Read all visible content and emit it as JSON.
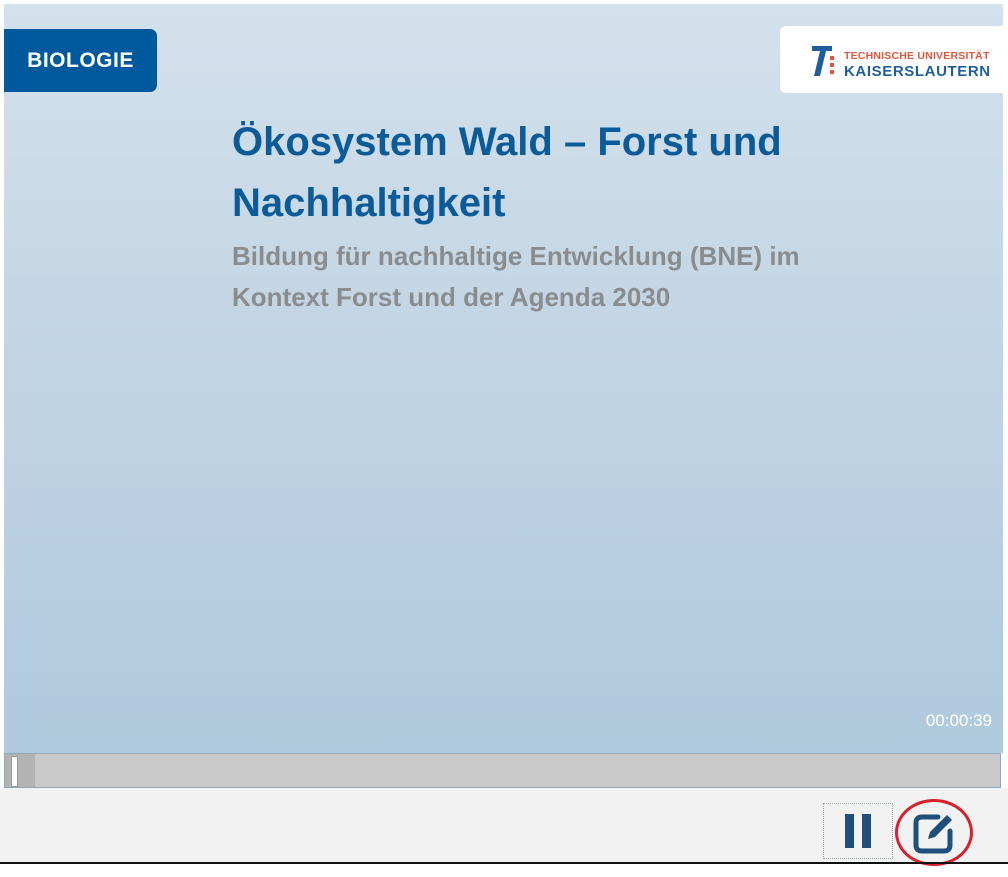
{
  "slide": {
    "badge": "BIOLOGIE",
    "logo": {
      "line1": "TECHNISCHE UNIVERSITÄT",
      "line2": "KAISERSLAUTERN"
    },
    "title_line1": "Ökosystem Wald – Forst und",
    "title_line2": "Nachhaltigkeit",
    "subtitle_line1": "Bildung für nachhaltige Entwicklung (BNE) im",
    "subtitle_line2": "Kontext Forst und der Agenda 2030"
  },
  "player": {
    "timestamp": "00:00:39",
    "progress": 0.03,
    "pause_icon": "pause-icon",
    "notes_icon": "edit-note-icon"
  },
  "colors": {
    "brand_blue": "#00599c",
    "title_blue": "#0c5b99",
    "subtitle_gray": "#8a8c8e",
    "logo_red": "#e0553d",
    "highlight_red": "#d8202e"
  }
}
